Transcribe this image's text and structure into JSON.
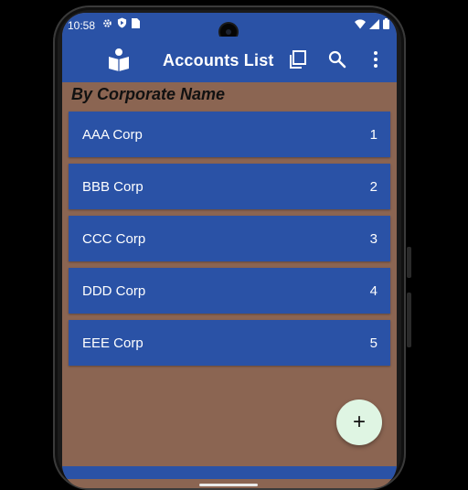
{
  "status": {
    "time": "10:58",
    "left_icons": [
      "gear-icon",
      "shield-icon",
      "sim-card-icon"
    ],
    "right_icons": [
      "wifi-icon",
      "signal-icon",
      "battery-icon"
    ]
  },
  "appbar": {
    "title": "Accounts List",
    "logo_icon": "book-reader-icon",
    "actions": [
      "copy-icon",
      "search-icon",
      "more-vert-icon"
    ]
  },
  "heading": "By Corporate Name",
  "accounts": [
    {
      "name": "AAA Corp",
      "count": "1"
    },
    {
      "name": "BBB Corp",
      "count": "2"
    },
    {
      "name": "CCC Corp",
      "count": "3"
    },
    {
      "name": "DDD Corp",
      "count": "4"
    },
    {
      "name": "EEE Corp",
      "count": "5"
    }
  ],
  "fab": {
    "label": "+"
  },
  "colors": {
    "primary": "#2a52a6",
    "background": "#8b6552",
    "fab": "#dff5e3"
  }
}
